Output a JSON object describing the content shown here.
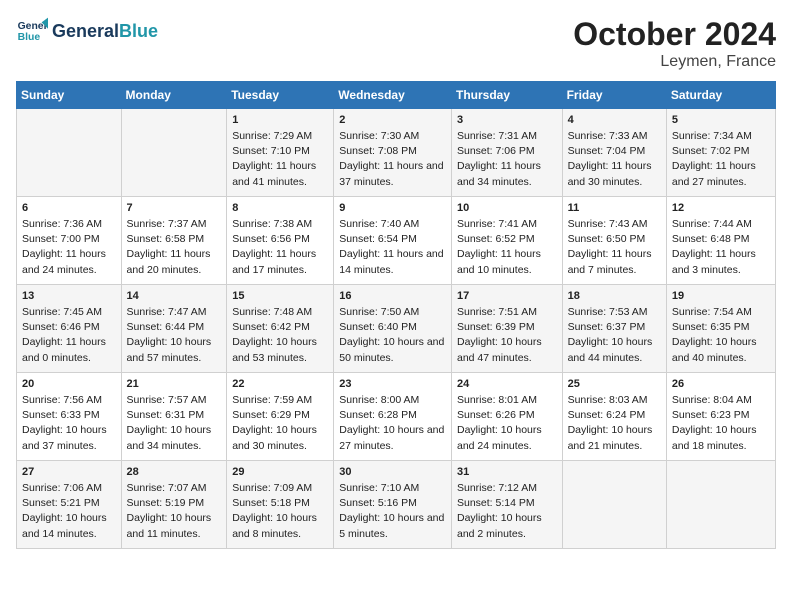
{
  "header": {
    "logo_line1": "General",
    "logo_line2": "Blue",
    "month": "October 2024",
    "location": "Leymen, France"
  },
  "weekdays": [
    "Sunday",
    "Monday",
    "Tuesday",
    "Wednesday",
    "Thursday",
    "Friday",
    "Saturday"
  ],
  "weeks": [
    [
      {
        "day": "",
        "sunrise": "",
        "sunset": "",
        "daylight": ""
      },
      {
        "day": "",
        "sunrise": "",
        "sunset": "",
        "daylight": ""
      },
      {
        "day": "1",
        "sunrise": "Sunrise: 7:29 AM",
        "sunset": "Sunset: 7:10 PM",
        "daylight": "Daylight: 11 hours and 41 minutes."
      },
      {
        "day": "2",
        "sunrise": "Sunrise: 7:30 AM",
        "sunset": "Sunset: 7:08 PM",
        "daylight": "Daylight: 11 hours and 37 minutes."
      },
      {
        "day": "3",
        "sunrise": "Sunrise: 7:31 AM",
        "sunset": "Sunset: 7:06 PM",
        "daylight": "Daylight: 11 hours and 34 minutes."
      },
      {
        "day": "4",
        "sunrise": "Sunrise: 7:33 AM",
        "sunset": "Sunset: 7:04 PM",
        "daylight": "Daylight: 11 hours and 30 minutes."
      },
      {
        "day": "5",
        "sunrise": "Sunrise: 7:34 AM",
        "sunset": "Sunset: 7:02 PM",
        "daylight": "Daylight: 11 hours and 27 minutes."
      }
    ],
    [
      {
        "day": "6",
        "sunrise": "Sunrise: 7:36 AM",
        "sunset": "Sunset: 7:00 PM",
        "daylight": "Daylight: 11 hours and 24 minutes."
      },
      {
        "day": "7",
        "sunrise": "Sunrise: 7:37 AM",
        "sunset": "Sunset: 6:58 PM",
        "daylight": "Daylight: 11 hours and 20 minutes."
      },
      {
        "day": "8",
        "sunrise": "Sunrise: 7:38 AM",
        "sunset": "Sunset: 6:56 PM",
        "daylight": "Daylight: 11 hours and 17 minutes."
      },
      {
        "day": "9",
        "sunrise": "Sunrise: 7:40 AM",
        "sunset": "Sunset: 6:54 PM",
        "daylight": "Daylight: 11 hours and 14 minutes."
      },
      {
        "day": "10",
        "sunrise": "Sunrise: 7:41 AM",
        "sunset": "Sunset: 6:52 PM",
        "daylight": "Daylight: 11 hours and 10 minutes."
      },
      {
        "day": "11",
        "sunrise": "Sunrise: 7:43 AM",
        "sunset": "Sunset: 6:50 PM",
        "daylight": "Daylight: 11 hours and 7 minutes."
      },
      {
        "day": "12",
        "sunrise": "Sunrise: 7:44 AM",
        "sunset": "Sunset: 6:48 PM",
        "daylight": "Daylight: 11 hours and 3 minutes."
      }
    ],
    [
      {
        "day": "13",
        "sunrise": "Sunrise: 7:45 AM",
        "sunset": "Sunset: 6:46 PM",
        "daylight": "Daylight: 11 hours and 0 minutes."
      },
      {
        "day": "14",
        "sunrise": "Sunrise: 7:47 AM",
        "sunset": "Sunset: 6:44 PM",
        "daylight": "Daylight: 10 hours and 57 minutes."
      },
      {
        "day": "15",
        "sunrise": "Sunrise: 7:48 AM",
        "sunset": "Sunset: 6:42 PM",
        "daylight": "Daylight: 10 hours and 53 minutes."
      },
      {
        "day": "16",
        "sunrise": "Sunrise: 7:50 AM",
        "sunset": "Sunset: 6:40 PM",
        "daylight": "Daylight: 10 hours and 50 minutes."
      },
      {
        "day": "17",
        "sunrise": "Sunrise: 7:51 AM",
        "sunset": "Sunset: 6:39 PM",
        "daylight": "Daylight: 10 hours and 47 minutes."
      },
      {
        "day": "18",
        "sunrise": "Sunrise: 7:53 AM",
        "sunset": "Sunset: 6:37 PM",
        "daylight": "Daylight: 10 hours and 44 minutes."
      },
      {
        "day": "19",
        "sunrise": "Sunrise: 7:54 AM",
        "sunset": "Sunset: 6:35 PM",
        "daylight": "Daylight: 10 hours and 40 minutes."
      }
    ],
    [
      {
        "day": "20",
        "sunrise": "Sunrise: 7:56 AM",
        "sunset": "Sunset: 6:33 PM",
        "daylight": "Daylight: 10 hours and 37 minutes."
      },
      {
        "day": "21",
        "sunrise": "Sunrise: 7:57 AM",
        "sunset": "Sunset: 6:31 PM",
        "daylight": "Daylight: 10 hours and 34 minutes."
      },
      {
        "day": "22",
        "sunrise": "Sunrise: 7:59 AM",
        "sunset": "Sunset: 6:29 PM",
        "daylight": "Daylight: 10 hours and 30 minutes."
      },
      {
        "day": "23",
        "sunrise": "Sunrise: 8:00 AM",
        "sunset": "Sunset: 6:28 PM",
        "daylight": "Daylight: 10 hours and 27 minutes."
      },
      {
        "day": "24",
        "sunrise": "Sunrise: 8:01 AM",
        "sunset": "Sunset: 6:26 PM",
        "daylight": "Daylight: 10 hours and 24 minutes."
      },
      {
        "day": "25",
        "sunrise": "Sunrise: 8:03 AM",
        "sunset": "Sunset: 6:24 PM",
        "daylight": "Daylight: 10 hours and 21 minutes."
      },
      {
        "day": "26",
        "sunrise": "Sunrise: 8:04 AM",
        "sunset": "Sunset: 6:23 PM",
        "daylight": "Daylight: 10 hours and 18 minutes."
      }
    ],
    [
      {
        "day": "27",
        "sunrise": "Sunrise: 7:06 AM",
        "sunset": "Sunset: 5:21 PM",
        "daylight": "Daylight: 10 hours and 14 minutes."
      },
      {
        "day": "28",
        "sunrise": "Sunrise: 7:07 AM",
        "sunset": "Sunset: 5:19 PM",
        "daylight": "Daylight: 10 hours and 11 minutes."
      },
      {
        "day": "29",
        "sunrise": "Sunrise: 7:09 AM",
        "sunset": "Sunset: 5:18 PM",
        "daylight": "Daylight: 10 hours and 8 minutes."
      },
      {
        "day": "30",
        "sunrise": "Sunrise: 7:10 AM",
        "sunset": "Sunset: 5:16 PM",
        "daylight": "Daylight: 10 hours and 5 minutes."
      },
      {
        "day": "31",
        "sunrise": "Sunrise: 7:12 AM",
        "sunset": "Sunset: 5:14 PM",
        "daylight": "Daylight: 10 hours and 2 minutes."
      },
      {
        "day": "",
        "sunrise": "",
        "sunset": "",
        "daylight": ""
      },
      {
        "day": "",
        "sunrise": "",
        "sunset": "",
        "daylight": ""
      }
    ]
  ]
}
